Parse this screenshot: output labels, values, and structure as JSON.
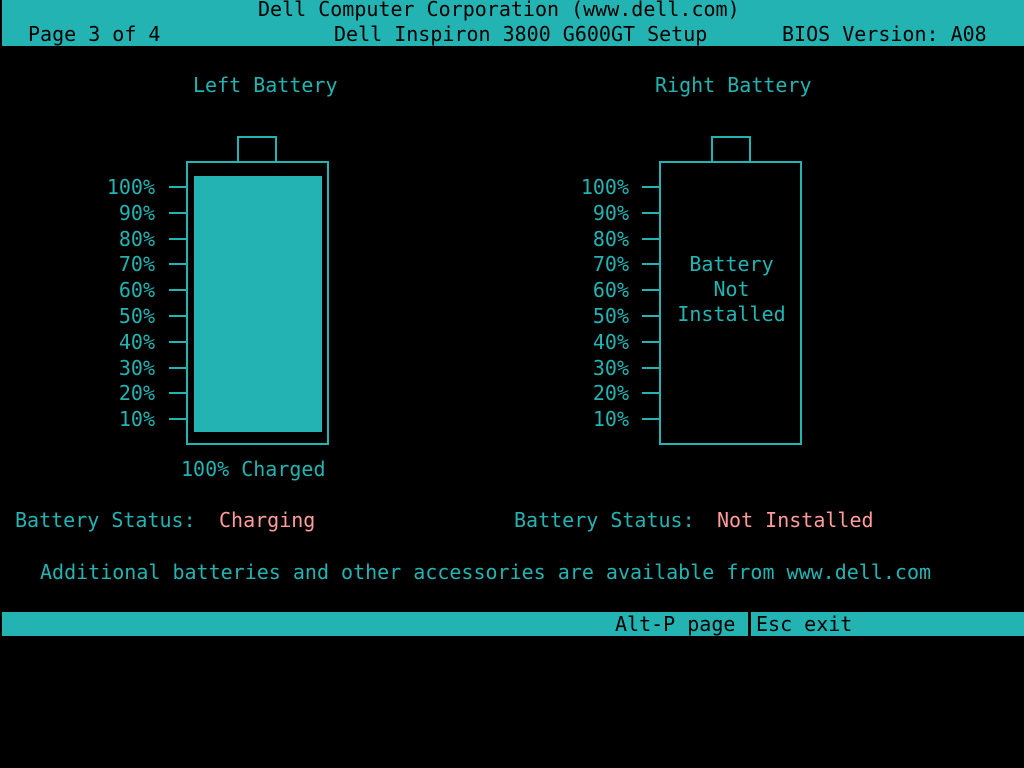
{
  "header": {
    "vendor": "Dell Computer Corporation (www.dell.com)",
    "page": "Page 3 of 4",
    "setup_title": "Dell Inspiron 3800 G600GT Setup",
    "bios_version": "BIOS Version: A08"
  },
  "scale": [
    "100%",
    "90%",
    "80%",
    "70%",
    "60%",
    "50%",
    "40%",
    "30%",
    "20%",
    "10%"
  ],
  "left_battery": {
    "title": "Left Battery",
    "charge_percent": 100,
    "charged_label": "100% Charged",
    "status_label": "Battery Status:",
    "status_value": "Charging"
  },
  "right_battery": {
    "title": "Right Battery",
    "message": [
      "Battery",
      "Not",
      "Installed"
    ],
    "status_label": "Battery Status:",
    "status_value": "Not Installed"
  },
  "note": "Additional batteries and other accessories are available from www.dell.com",
  "footer": {
    "page_key": "Alt-P page",
    "exit_key": "Esc exit"
  },
  "colors": {
    "primary": "#23b3b3",
    "highlight": "#ff9c9c",
    "background": "#000000"
  }
}
